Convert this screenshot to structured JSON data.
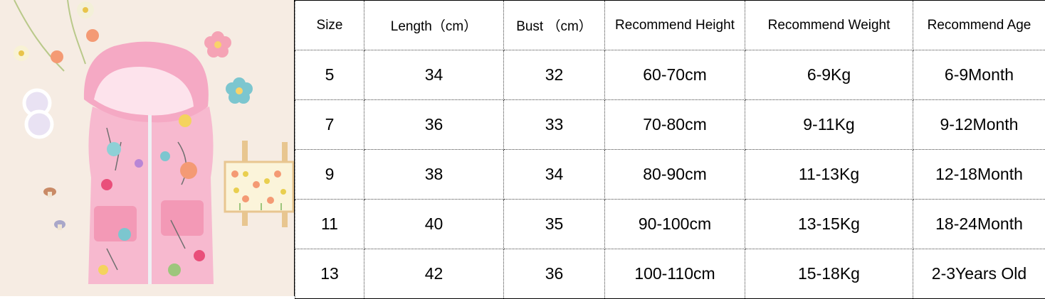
{
  "photo": {
    "alt_icon": "pink-hooded-vest-product-photo",
    "colors": {
      "background": "#f6ece3",
      "vest": "#f7b9cf",
      "hood_lining": "#fde3ec",
      "flower_orange": "#f49a74",
      "flower_blue": "#7cc6cf",
      "wood": "#e8c690"
    }
  },
  "size_chart": {
    "headers": [
      "Size",
      "Length（cm）",
      "Bust （cm）",
      "Recommend Height",
      "Recommend Weight",
      "Recommend Age"
    ],
    "rows": [
      [
        "5",
        "34",
        "32",
        "60-70cm",
        "6-9Kg",
        "6-9Month"
      ],
      [
        "7",
        "36",
        "33",
        "70-80cm",
        "9-11Kg",
        "9-12Month"
      ],
      [
        "9",
        "38",
        "34",
        "80-90cm",
        "11-13Kg",
        "12-18Month"
      ],
      [
        "11",
        "40",
        "35",
        "90-100cm",
        "13-15Kg",
        "18-24Month"
      ],
      [
        "13",
        "42",
        "36",
        "100-110cm",
        "15-18Kg",
        "2-3Years Old"
      ]
    ]
  }
}
